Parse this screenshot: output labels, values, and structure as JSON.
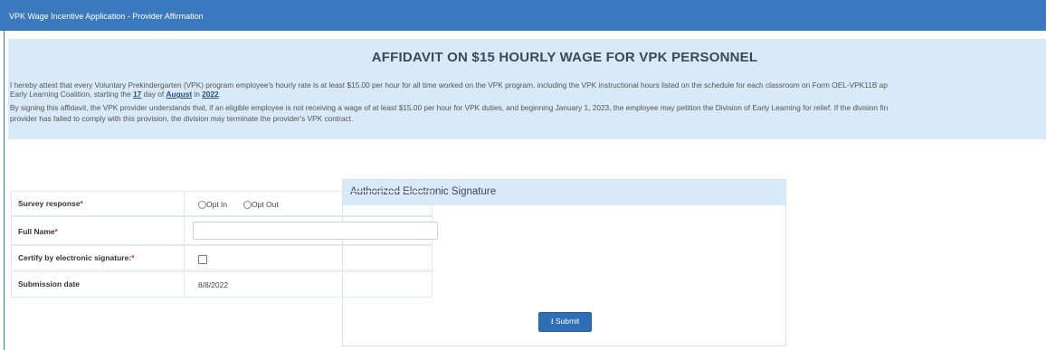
{
  "header": {
    "title": "VPK Wage Incentive Application - Provider Affirmation"
  },
  "affidavit": {
    "heading": "AFFIDAVIT ON $15 HOURLY WAGE FOR VPK PERSONNEL",
    "para1_start": "I hereby attest that every Voluntary Prekindergarten (VPK) program employee's hourly rate is at least $15.00 per hour for all time worked on the VPK program, including the VPK instructional hours listed on the schedule for each classroom on Form OEL-VPK11B ap",
    "para1_cont": "Early Learning Coalition, starting the ",
    "day": "17",
    "day_suffix": " day of ",
    "month": "August",
    "in_word": " in ",
    "year": "2022",
    "period": ".",
    "para2_line1": "By signing this affidavit, the VPK provider understands that, if an eligible employee is not receiving a wage of at least $15.00 per hour for VPK duties, and beginning January 1, 2023, the employee may petition the Division of Early Learning for relief. If the division fin",
    "para2_line2": "provider has failed to comply with this provision, the division may terminate the provider's VPK contract."
  },
  "signature_form": {
    "title": "Authorized Electronic Signature",
    "survey_label": "Survey response",
    "opt_in": "Opt In",
    "opt_out": "Opt Out",
    "full_name_label": "Full Name",
    "full_name_value": "",
    "certify_label": "Certify by electronic signature:",
    "submission_date_label": "Submission date",
    "submission_date_value": "8/8/2022",
    "required_marker": "*",
    "submit_label": "Submit",
    "submit_icon": "upload-icon"
  }
}
